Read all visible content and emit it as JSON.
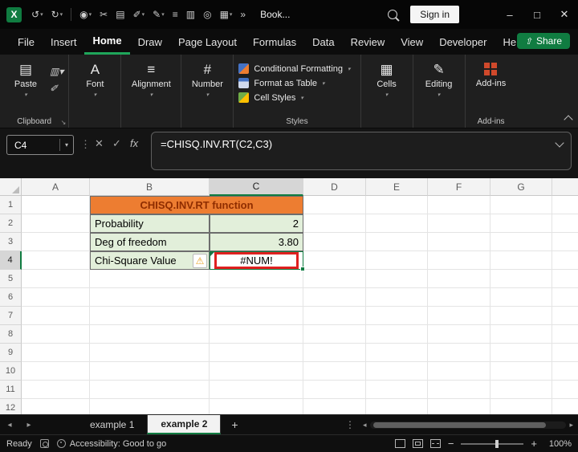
{
  "titlebar": {
    "workbook_name": "Book...",
    "sign_in_label": "Sign in"
  },
  "ribbon": {
    "tabs": [
      "File",
      "Insert",
      "Home",
      "Draw",
      "Page Layout",
      "Formulas",
      "Data",
      "Review",
      "View",
      "Developer",
      "Help"
    ],
    "active_tab": "Home",
    "share_label": "Share",
    "paste_label": "Paste",
    "font_label": "Font",
    "alignment_label": "Alignment",
    "number_label": "Number",
    "conditional_formatting_label": "Conditional Formatting",
    "format_as_table_label": "Format as Table",
    "cell_styles_label": "Cell Styles",
    "cells_label": "Cells",
    "editing_label": "Editing",
    "addins_label": "Add-ins",
    "group_labels": {
      "clipboard": "Clipboard",
      "styles": "Styles",
      "addins": "Add-ins"
    }
  },
  "formula_bar": {
    "name_box": "C4",
    "fx_label": "fx",
    "formula": "=CHISQ.INV.RT(C2,C3)"
  },
  "sheet": {
    "columns": [
      "A",
      "B",
      "C",
      "D",
      "E",
      "F",
      "G"
    ],
    "rows": [
      "1",
      "2",
      "3",
      "4",
      "5",
      "6",
      "7",
      "8",
      "9",
      "10",
      "11",
      "12"
    ],
    "selected_cell": "C4",
    "cells": {
      "title": "CHISQ.INV.RT function",
      "probability_label": "Probability",
      "probability_value": "2",
      "dof_label": "Deg of freedom",
      "dof_value": "3.80",
      "chi_label": "Chi-Square Value",
      "result_value": "#NUM!"
    }
  },
  "sheet_tabs": {
    "tabs": [
      "example 1",
      "example 2"
    ],
    "active": "example 2"
  },
  "status_bar": {
    "ready_label": "Ready",
    "accessibility_label": "Accessibility: Good to go",
    "zoom_level": "100%"
  },
  "colors": {
    "accent_green": "#107C41",
    "header_fill_orange": "#ED7D31",
    "input_fill_green": "#E2EFDA",
    "error_box_red": "#E02020"
  }
}
